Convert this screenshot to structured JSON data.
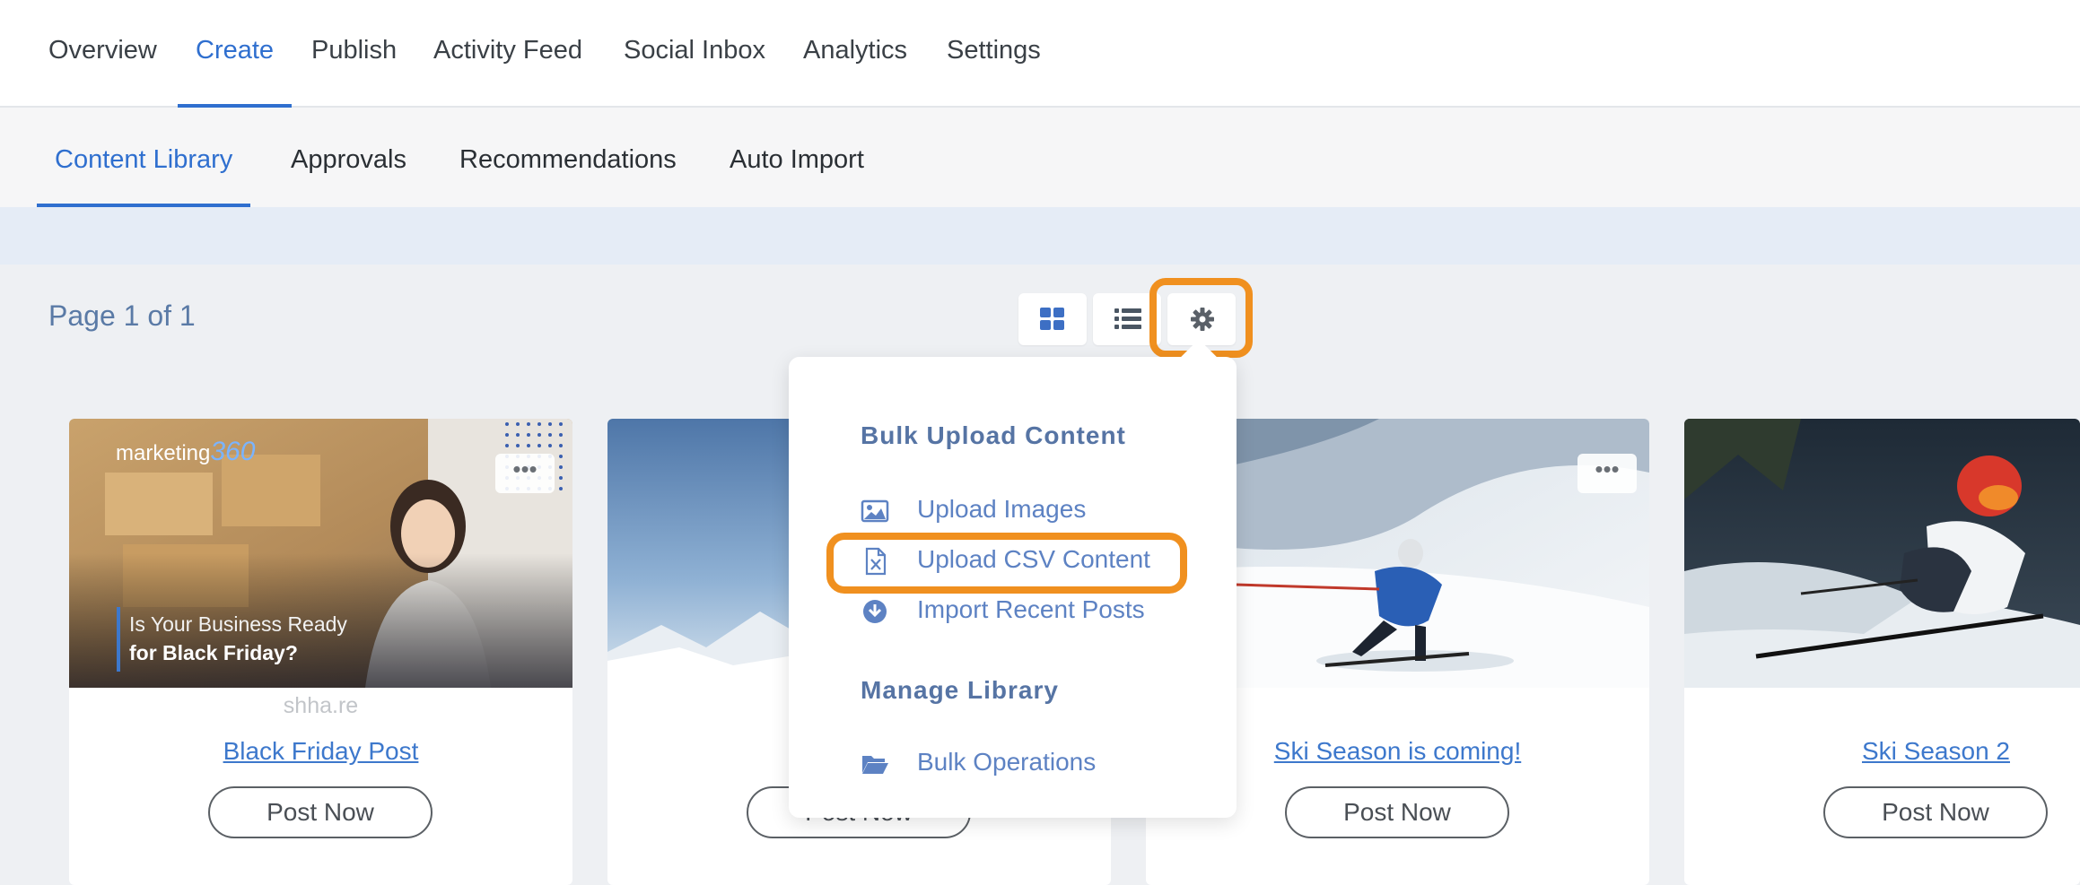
{
  "top_nav": {
    "items": [
      {
        "label": "Overview"
      },
      {
        "label": "Create",
        "active": true
      },
      {
        "label": "Publish"
      },
      {
        "label": "Activity Feed"
      },
      {
        "label": "Social Inbox"
      },
      {
        "label": "Analytics"
      },
      {
        "label": "Settings"
      }
    ]
  },
  "sub_nav": {
    "items": [
      {
        "label": "Content Library",
        "active": true
      },
      {
        "label": "Approvals"
      },
      {
        "label": "Recommendations"
      },
      {
        "label": "Auto Import"
      }
    ]
  },
  "page_info": "Page 1 of 1",
  "view_toggles": {
    "grid_icon": "grid-icon",
    "list_icon": "list-icon",
    "settings_icon": "gear-icon"
  },
  "dropdown": {
    "bulk_header": "Bulk Upload Content",
    "items": [
      {
        "label": "Upload Images",
        "icon": "image-icon"
      },
      {
        "label": "Upload CSV Content",
        "icon": "csv-file-icon"
      },
      {
        "label": "Import Recent Posts",
        "icon": "download-circle-icon"
      }
    ],
    "manage_header": "Manage Library",
    "manage_items": [
      {
        "label": "Bulk Operations",
        "icon": "folder-open-icon"
      }
    ]
  },
  "cards": [
    {
      "title": "Black Friday Post",
      "domain": "shha.re",
      "button": "Post Now",
      "overlay_brand": "marketing",
      "overlay_brand_num": "360",
      "overlay_line1": "Is Your Business Ready",
      "overlay_line2": "for Black Friday?"
    },
    {
      "title": "",
      "button": "Post Now"
    },
    {
      "title": "Ski Season is coming!",
      "button": "Post Now"
    },
    {
      "title": "Ski Season 2",
      "button": "Post Now"
    }
  ],
  "colors": {
    "accent": "#2f6fcf",
    "highlight": "#f0901f",
    "link": "#3d78cc"
  }
}
